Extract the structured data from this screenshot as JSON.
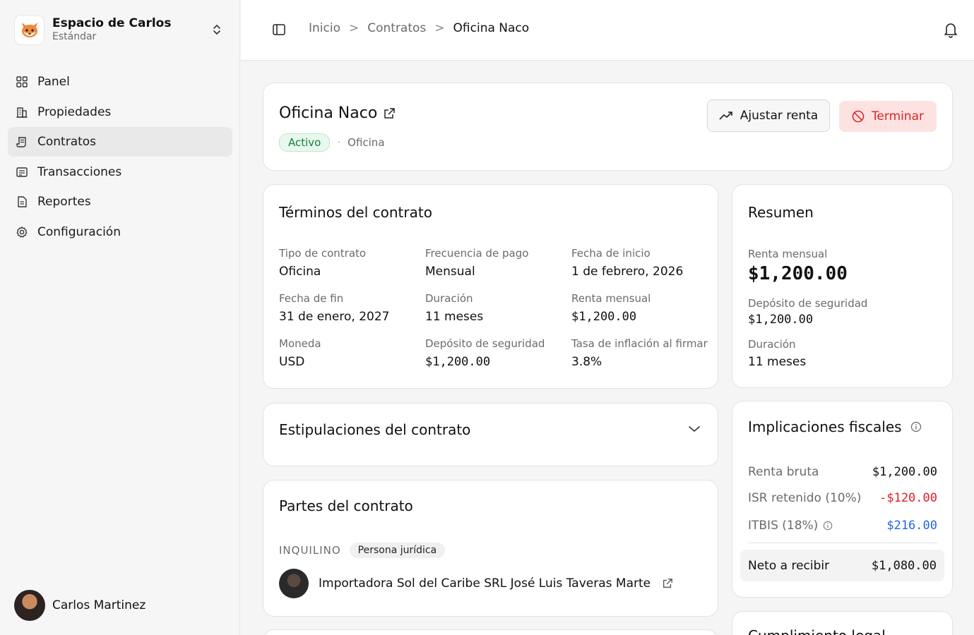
{
  "workspace": {
    "name": "Espacio de Carlos",
    "plan": "Estándar"
  },
  "nav": [
    {
      "label": "Panel",
      "icon": "grid-icon"
    },
    {
      "label": "Propiedades",
      "icon": "building-icon"
    },
    {
      "label": "Contratos",
      "icon": "contract-icon",
      "active": true
    },
    {
      "label": "Transacciones",
      "icon": "receipt-icon"
    },
    {
      "label": "Reportes",
      "icon": "document-icon"
    },
    {
      "label": "Configuración",
      "icon": "gear-icon"
    }
  ],
  "user": {
    "name": "Carlos Martinez"
  },
  "breadcrumb": {
    "home": "Inicio",
    "section": "Contratos",
    "current": "Oficina Naco"
  },
  "contract": {
    "title": "Oficina Naco",
    "status": "Activo",
    "type_label": "Oficina",
    "adjust_button": "Ajustar renta",
    "terminate_button": "Terminar"
  },
  "terms": {
    "title": "Términos del contrato",
    "items": [
      {
        "label": "Tipo de contrato",
        "value": "Oficina"
      },
      {
        "label": "Frecuencia de pago",
        "value": "Mensual"
      },
      {
        "label": "Fecha de inicio",
        "value": "1 de febrero, 2026"
      },
      {
        "label": "Fecha de fin",
        "value": "31 de enero, 2027"
      },
      {
        "label": "Duración",
        "value": "11 meses"
      },
      {
        "label": "Renta mensual",
        "value": "$1,200.00"
      },
      {
        "label": "Moneda",
        "value": "USD"
      },
      {
        "label": "Depósito de seguridad",
        "value": "$1,200.00"
      },
      {
        "label": "Tasa de inflación al firmar",
        "value": "3.8%"
      }
    ]
  },
  "summary": {
    "title": "Resumen",
    "rent_label": "Renta mensual",
    "rent_value": "$1,200.00",
    "deposit_label": "Depósito de seguridad",
    "deposit_value": "$1,200.00",
    "duration_label": "Duración",
    "duration_value": "11 meses"
  },
  "stipulations": {
    "title": "Estipulaciones del contrato"
  },
  "fiscal": {
    "title": "Implicaciones fiscales",
    "rows": [
      {
        "label": "Renta bruta",
        "value": "$1,200.00"
      },
      {
        "label": "ISR retenido (10%)",
        "value": "-$120.00"
      },
      {
        "label": "ITBIS (18%)",
        "value": "$216.00"
      }
    ],
    "net_label": "Neto a recibir",
    "net_value": "$1,080.00",
    "colors": {
      "negative": "#e11d2a",
      "positive": "#2563eb"
    }
  },
  "parties": {
    "title": "Partes del contrato",
    "role": "INQUILINO",
    "role_type": "Persona jurídica",
    "tenant_name": "Importadora Sol del Caribe SRL José Luis Taveras Marte"
  },
  "legal": {
    "title": "Cumplimiento legal"
  }
}
